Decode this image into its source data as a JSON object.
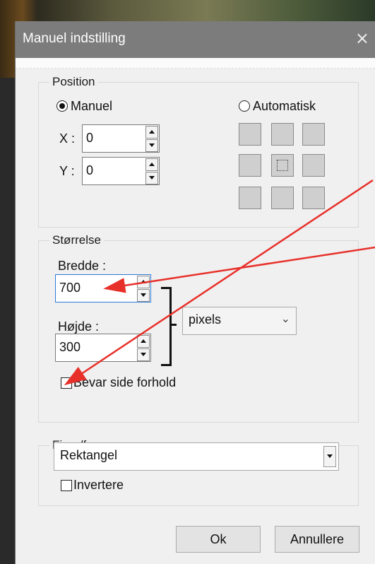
{
  "dialog": {
    "title": "Manuel indstilling",
    "close_glyph": "×"
  },
  "position": {
    "legend": "Position",
    "manual_label": "Manuel",
    "auto_label": "Automatisk",
    "x_label": "X :",
    "y_label": "Y :",
    "x_value": "0",
    "y_value": "0"
  },
  "size": {
    "legend": "Størrelse",
    "width_label": "Bredde :",
    "width_value": "700",
    "height_label": "Højde :",
    "height_value": "300",
    "unit": "pixels",
    "keep_ratio_label": "Bevar side forhold"
  },
  "shape": {
    "legend": "Figur/form",
    "value": "Rektangel",
    "invert_label": "Invertere"
  },
  "buttons": {
    "ok": "Ok",
    "cancel": "Annullere"
  },
  "annotation_color": "#e8302a"
}
